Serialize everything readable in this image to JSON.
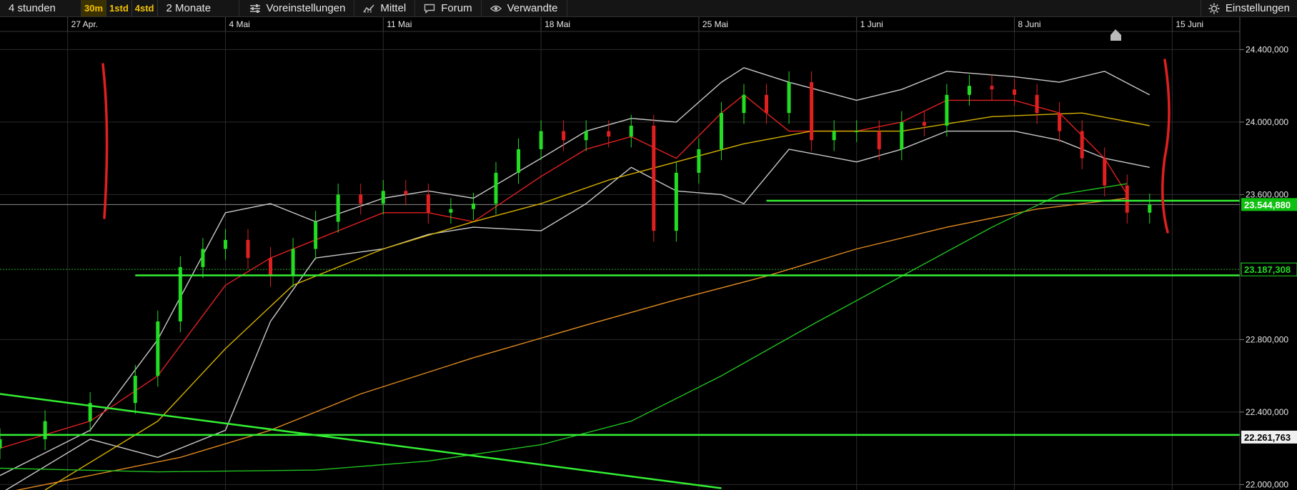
{
  "toolbar": {
    "period": "4 stunden",
    "intervals": [
      "30m",
      "1std",
      "4std"
    ],
    "selected_interval": "30m",
    "range": "2 Monate",
    "presets": "Voreinstellungen",
    "average": "Mittel",
    "forum": "Forum",
    "related": "Verwandte",
    "settings": "Einstellungen"
  },
  "colors": {
    "background": "#000000",
    "candle_up": "#22dd22",
    "candle_down": "#e02020",
    "bollinger": "#c8c8c8",
    "ma_short": "#e02020",
    "ma_mid": "#d4b000",
    "ma_long_orange": "#e08a20",
    "ma_long_green": "#20c020",
    "trend_line": "#33ee33",
    "marker": "#e02020"
  },
  "chart_data": {
    "type": "candlestick",
    "x_tick_labels": [
      "27 Apr.",
      "4 Mai",
      "11 Mai",
      "18 Mai",
      "25 Mai",
      "1 Juni",
      "8 Juni",
      "15 Juni"
    ],
    "x_range": [
      "2020-04-24",
      "2020-06-18"
    ],
    "y_tick_labels": [
      "24.400,000",
      "24.000,000",
      "23.600,000",
      "22.800,000",
      "22.400,000",
      "22.000,000"
    ],
    "ylim": [
      21.97,
      24.5
    ],
    "y_unit_scale": 1000,
    "grid": true,
    "price_tags": [
      {
        "label": "23.544,880",
        "value": 23.545,
        "style": "filled"
      },
      {
        "label": "23.187,308",
        "value": 23.187,
        "style": "outline"
      },
      {
        "label": "22.261,763",
        "value": 22.262,
        "style": "white"
      }
    ],
    "horizontal_lines": [
      {
        "value": 23.566,
        "from": "2020-05-28",
        "to": "2020-06-18"
      },
      {
        "value": 23.154,
        "from": "2020-04-30",
        "to": "2020-06-18"
      },
      {
        "value": 22.274,
        "from": "2020-04-24",
        "to": "2020-06-18"
      }
    ],
    "reference_lines": [
      {
        "value": 23.545,
        "style": "solid-thin"
      },
      {
        "value": 23.187,
        "style": "dotted"
      }
    ],
    "trend_line": {
      "from": [
        "2020-04-24",
        22.5
      ],
      "to": [
        "2020-05-26",
        21.98
      ]
    },
    "series": [
      {
        "kind": "bollinger_upper",
        "x": [
          "2020-04-24",
          "2020-04-28",
          "2020-05-01",
          "2020-05-04",
          "2020-05-06",
          "2020-05-08",
          "2020-05-11",
          "2020-05-13",
          "2020-05-15",
          "2020-05-18",
          "2020-05-20",
          "2020-05-22",
          "2020-05-24",
          "2020-05-26",
          "2020-05-27",
          "2020-05-29",
          "2020-06-01",
          "2020-06-03",
          "2020-06-05",
          "2020-06-08",
          "2020-06-10",
          "2020-06-12",
          "2020-06-14"
        ],
        "values": [
          22.05,
          22.3,
          22.8,
          23.5,
          23.55,
          23.45,
          23.58,
          23.62,
          23.58,
          23.8,
          23.95,
          24.02,
          24.0,
          24.22,
          24.3,
          24.22,
          24.12,
          24.18,
          24.28,
          24.25,
          24.22,
          24.28,
          24.15
        ]
      },
      {
        "kind": "bollinger_lower",
        "x": [
          "2020-04-24",
          "2020-04-28",
          "2020-05-01",
          "2020-05-04",
          "2020-05-06",
          "2020-05-08",
          "2020-05-11",
          "2020-05-13",
          "2020-05-15",
          "2020-05-18",
          "2020-05-20",
          "2020-05-22",
          "2020-05-24",
          "2020-05-26",
          "2020-05-27",
          "2020-05-29",
          "2020-06-01",
          "2020-06-03",
          "2020-06-05",
          "2020-06-08",
          "2020-06-10",
          "2020-06-12",
          "2020-06-14"
        ],
        "values": [
          21.95,
          22.25,
          22.15,
          22.3,
          22.9,
          23.25,
          23.3,
          23.38,
          23.42,
          23.4,
          23.55,
          23.75,
          23.62,
          23.6,
          23.55,
          23.85,
          23.78,
          23.85,
          23.95,
          23.95,
          23.9,
          23.8,
          23.75
        ]
      },
      {
        "kind": "ma_short",
        "x": [
          "2020-04-24",
          "2020-04-28",
          "2020-05-01",
          "2020-05-04",
          "2020-05-06",
          "2020-05-08",
          "2020-05-11",
          "2020-05-13",
          "2020-05-15",
          "2020-05-18",
          "2020-05-20",
          "2020-05-22",
          "2020-05-24",
          "2020-05-26",
          "2020-05-27",
          "2020-05-29",
          "2020-06-01",
          "2020-06-03",
          "2020-06-05",
          "2020-06-08",
          "2020-06-10",
          "2020-06-12",
          "2020-06-13"
        ],
        "values": [
          22.2,
          22.35,
          22.6,
          23.1,
          23.25,
          23.35,
          23.5,
          23.5,
          23.45,
          23.7,
          23.85,
          23.92,
          23.8,
          24.05,
          24.15,
          23.95,
          23.95,
          24.0,
          24.12,
          24.12,
          24.05,
          23.8,
          23.6
        ]
      },
      {
        "kind": "ma_mid",
        "x": [
          "2020-04-26",
          "2020-05-01",
          "2020-05-04",
          "2020-05-07",
          "2020-05-11",
          "2020-05-15",
          "2020-05-18",
          "2020-05-21",
          "2020-05-24",
          "2020-05-27",
          "2020-05-30",
          "2020-06-03",
          "2020-06-07",
          "2020-06-11",
          "2020-06-14"
        ],
        "values": [
          21.97,
          22.35,
          22.75,
          23.1,
          23.3,
          23.45,
          23.55,
          23.68,
          23.78,
          23.88,
          23.95,
          23.95,
          24.03,
          24.05,
          23.98
        ]
      },
      {
        "kind": "ma_long_orange",
        "x": [
          "2020-04-24",
          "2020-04-28",
          "2020-05-02",
          "2020-05-06",
          "2020-05-10",
          "2020-05-15",
          "2020-05-20",
          "2020-05-24",
          "2020-05-28",
          "2020-06-01",
          "2020-06-05",
          "2020-06-09",
          "2020-06-13"
        ],
        "values": [
          21.95,
          22.05,
          22.15,
          22.3,
          22.5,
          22.7,
          22.88,
          23.02,
          23.15,
          23.3,
          23.42,
          23.52,
          23.58
        ]
      },
      {
        "kind": "ma_long_green",
        "x": [
          "2020-04-24",
          "2020-05-01",
          "2020-05-08",
          "2020-05-13",
          "2020-05-18",
          "2020-05-22",
          "2020-05-26",
          "2020-05-30",
          "2020-06-03",
          "2020-06-07",
          "2020-06-10",
          "2020-06-13"
        ],
        "values": [
          22.09,
          22.07,
          22.08,
          22.13,
          22.22,
          22.35,
          22.6,
          22.88,
          23.15,
          23.42,
          23.6,
          23.66
        ]
      }
    ],
    "candles": {
      "x": [
        "2020-04-24",
        "2020-04-26",
        "2020-04-28",
        "2020-04-30",
        "2020-05-01",
        "2020-05-02",
        "2020-05-03",
        "2020-05-04",
        "2020-05-05",
        "2020-05-06",
        "2020-05-07",
        "2020-05-08",
        "2020-05-09",
        "2020-05-10",
        "2020-05-11",
        "2020-05-12",
        "2020-05-13",
        "2020-05-14",
        "2020-05-15",
        "2020-05-16",
        "2020-05-17",
        "2020-05-18",
        "2020-05-19",
        "2020-05-20",
        "2020-05-21",
        "2020-05-22",
        "2020-05-23",
        "2020-05-24",
        "2020-05-25",
        "2020-05-26",
        "2020-05-27",
        "2020-05-28",
        "2020-05-29",
        "2020-05-30",
        "2020-05-31",
        "2020-06-01",
        "2020-06-02",
        "2020-06-03",
        "2020-06-04",
        "2020-06-05",
        "2020-06-06",
        "2020-06-07",
        "2020-06-08",
        "2020-06-09",
        "2020-06-10",
        "2020-06-11",
        "2020-06-12",
        "2020-06-13",
        "2020-06-14"
      ],
      "values": [
        22.25,
        22.35,
        22.45,
        22.6,
        22.9,
        23.2,
        23.3,
        23.35,
        23.25,
        23.15,
        23.3,
        23.45,
        23.6,
        23.55,
        23.62,
        23.6,
        23.5,
        23.52,
        23.55,
        23.72,
        23.85,
        23.95,
        23.9,
        23.95,
        23.92,
        23.98,
        23.4,
        23.72,
        23.85,
        24.05,
        24.15,
        24.05,
        24.22,
        23.9,
        23.95,
        23.95,
        23.85,
        24.0,
        23.98,
        24.15,
        24.2,
        24.18,
        24.15,
        24.05,
        23.95,
        23.8,
        23.65,
        23.5,
        23.545
      ]
    }
  }
}
